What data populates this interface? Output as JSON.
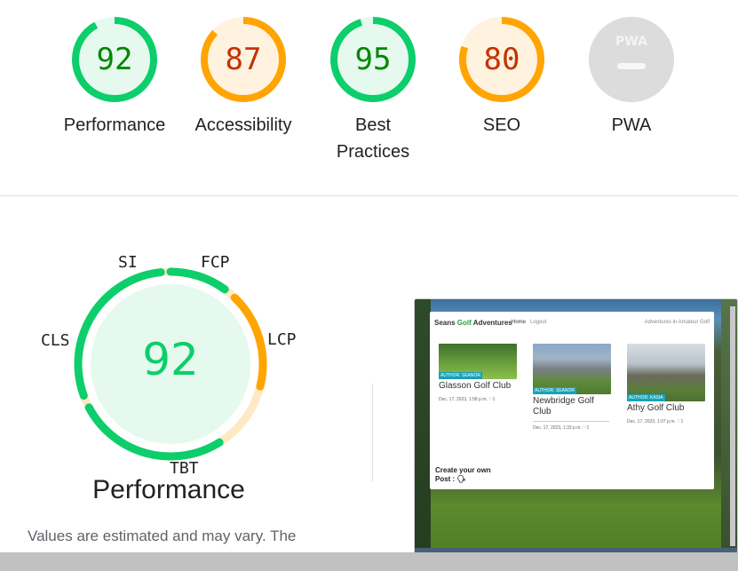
{
  "gauges": [
    {
      "score": "92",
      "label": "Performance",
      "fraction": 0.92,
      "color": "#0cce6b",
      "bg": "#e6f9ee",
      "text_color": "#008800"
    },
    {
      "score": "87",
      "label": "Accessibility",
      "fraction": 0.87,
      "color": "#ffa400",
      "bg": "#fff3e0",
      "text_color": "#c33300"
    },
    {
      "score": "95",
      "label": "Best Practices",
      "fraction": 0.95,
      "color": "#0cce6b",
      "bg": "#e6f9ee",
      "text_color": "#008800"
    },
    {
      "score": "80",
      "label": "SEO",
      "fraction": 0.8,
      "color": "#ffa400",
      "bg": "#fff3e0",
      "text_color": "#c33300"
    },
    {
      "score": "PWA",
      "label": "PWA",
      "color": "#cccccc",
      "icon": "pwa-badge-icon"
    }
  ],
  "metrics_gauge": {
    "score": "92",
    "title": "Performance",
    "labels": {
      "si": "SI",
      "fcp": "FCP",
      "lcp": "LCP",
      "tbt": "TBT",
      "cls": "CLS"
    },
    "colors": {
      "pass": "#0cce6b",
      "average": "#ffa400",
      "fill": "#e6f9ee"
    }
  },
  "note": "Values are estimated and may vary. The",
  "screenshot": {
    "brand_prefix": "Seans ",
    "brand_g": "Golf",
    "brand_suffix": " Adventures",
    "nav_home": "Home",
    "nav_logout": "Logout",
    "nav_tagline": "Adventures in Amateur Golf",
    "posts": [
      {
        "title": "Glasson Golf Club",
        "author": "AUTHOR: SEANOR",
        "meta": "Dec. 17, 2023, 1:58 p.m. ♡1"
      },
      {
        "title": "Newbridge Golf Club",
        "author": "AUTHOR: SEANOR",
        "meta": "Dec. 17, 2023, 1:33 p.m. ♡1"
      },
      {
        "title": "Athy Golf Club",
        "author": "AUTHOR: KASIA",
        "meta": "Dec. 17, 2023, 1:07 p.m. ♡1"
      }
    ],
    "create_post": "Create your own Post : 🗣"
  }
}
